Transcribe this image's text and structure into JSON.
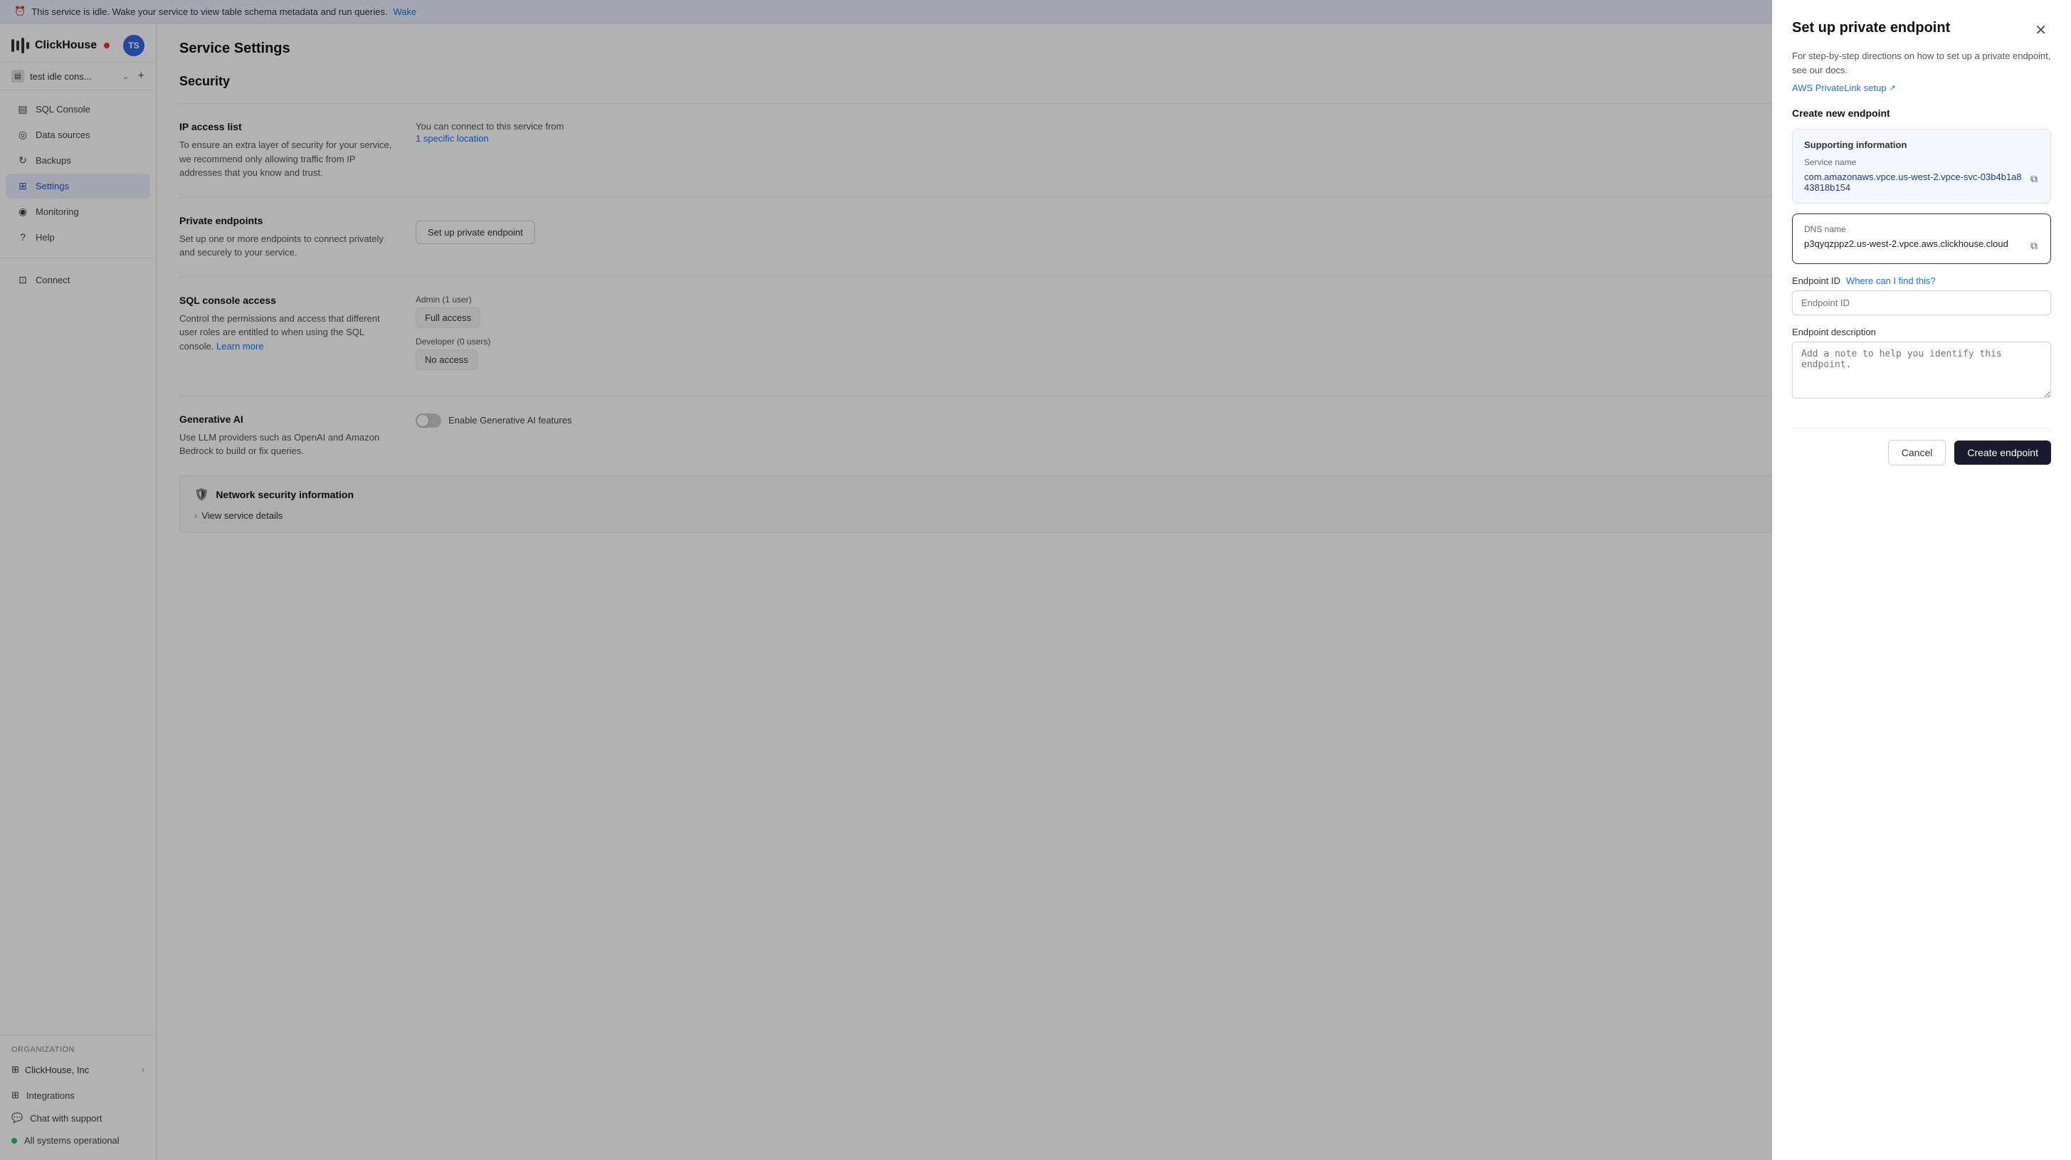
{
  "banner": {
    "message": "This service is idle. Wake your service to view table schema metadata and run queries.",
    "link_text": "Wake",
    "icon": "⏰"
  },
  "sidebar": {
    "logo": "ClickHouse",
    "avatar": "TS",
    "service_name": "test idle cons...",
    "nav_items": [
      {
        "id": "sql-console",
        "label": "SQL Console",
        "icon": "▤"
      },
      {
        "id": "data-sources",
        "label": "Data sources",
        "icon": "⊕"
      },
      {
        "id": "backups",
        "label": "Backups",
        "icon": "↻"
      },
      {
        "id": "settings",
        "label": "Settings",
        "icon": "⊞",
        "active": true
      },
      {
        "id": "monitoring",
        "label": "Monitoring",
        "icon": "◎"
      },
      {
        "id": "help",
        "label": "Help",
        "icon": "?"
      }
    ],
    "org_label": "Organization",
    "org_name": "ClickHouse, Inc",
    "bottom_items": [
      {
        "id": "integrations",
        "label": "Integrations",
        "icon": "⊞"
      },
      {
        "id": "chat-support",
        "label": "Chat with support",
        "icon": "💬"
      },
      {
        "id": "systems-status",
        "label": "All systems operational",
        "icon": "dot"
      }
    ],
    "connect_label": "Connect"
  },
  "main": {
    "page_title": "Service Settings",
    "section_title": "Security",
    "ip_access": {
      "label": "IP access list",
      "description": "To ensure an extra layer of security for your service, we recommend only allowing traffic from IP addresses that you know and trust.",
      "info_prefix": "You can connect to this service from",
      "location_link": "1 specific location"
    },
    "private_endpoints": {
      "label": "Private endpoints",
      "description": "Set up one or more endpoints to connect privately and securely to your service.",
      "button": "Set up private endpoint"
    },
    "sql_console": {
      "label": "SQL console access",
      "description": "Control the permissions and access that different user roles are entitled to when using the SQL console.",
      "learn_more": "Learn more",
      "admin_label": "Admin (1 user)",
      "admin_access": "Full access",
      "developer_label": "Developer (0 users)",
      "developer_access": "No access"
    },
    "generative_ai": {
      "label": "Generative AI",
      "description": "Use LLM providers such as OpenAI and Amazon Bedrock to build or fix queries.",
      "toggle_label": "Enable Generative AI features"
    },
    "network_security": {
      "label": "Network security information",
      "view_details": "View service details"
    }
  },
  "panel": {
    "title": "Set up private endpoint",
    "desc": "For step-by-step directions on how to set up a private endpoint, see our docs.",
    "link_text": "AWS PrivateLink setup",
    "link_icon": "↗",
    "create_section": "Create new endpoint",
    "supporting_info": "Supporting information",
    "service_name_label": "Service name",
    "service_name_value": "com.amazonaws.vpce.us-west-2.vpce-svc-03b4b1a843818b154",
    "dns_name_label": "DNS name",
    "dns_name_value": "p3qyqzppz2.us-west-2.vpce.aws.clickhouse.cloud",
    "endpoint_id_label": "Endpoint ID",
    "endpoint_id_where": "Where can I find this?",
    "endpoint_id_placeholder": "Endpoint ID",
    "endpoint_desc_label": "Endpoint description",
    "endpoint_desc_placeholder": "Add a note to help you identify this endpoint.",
    "cancel_btn": "Cancel",
    "create_btn": "Create endpoint"
  }
}
